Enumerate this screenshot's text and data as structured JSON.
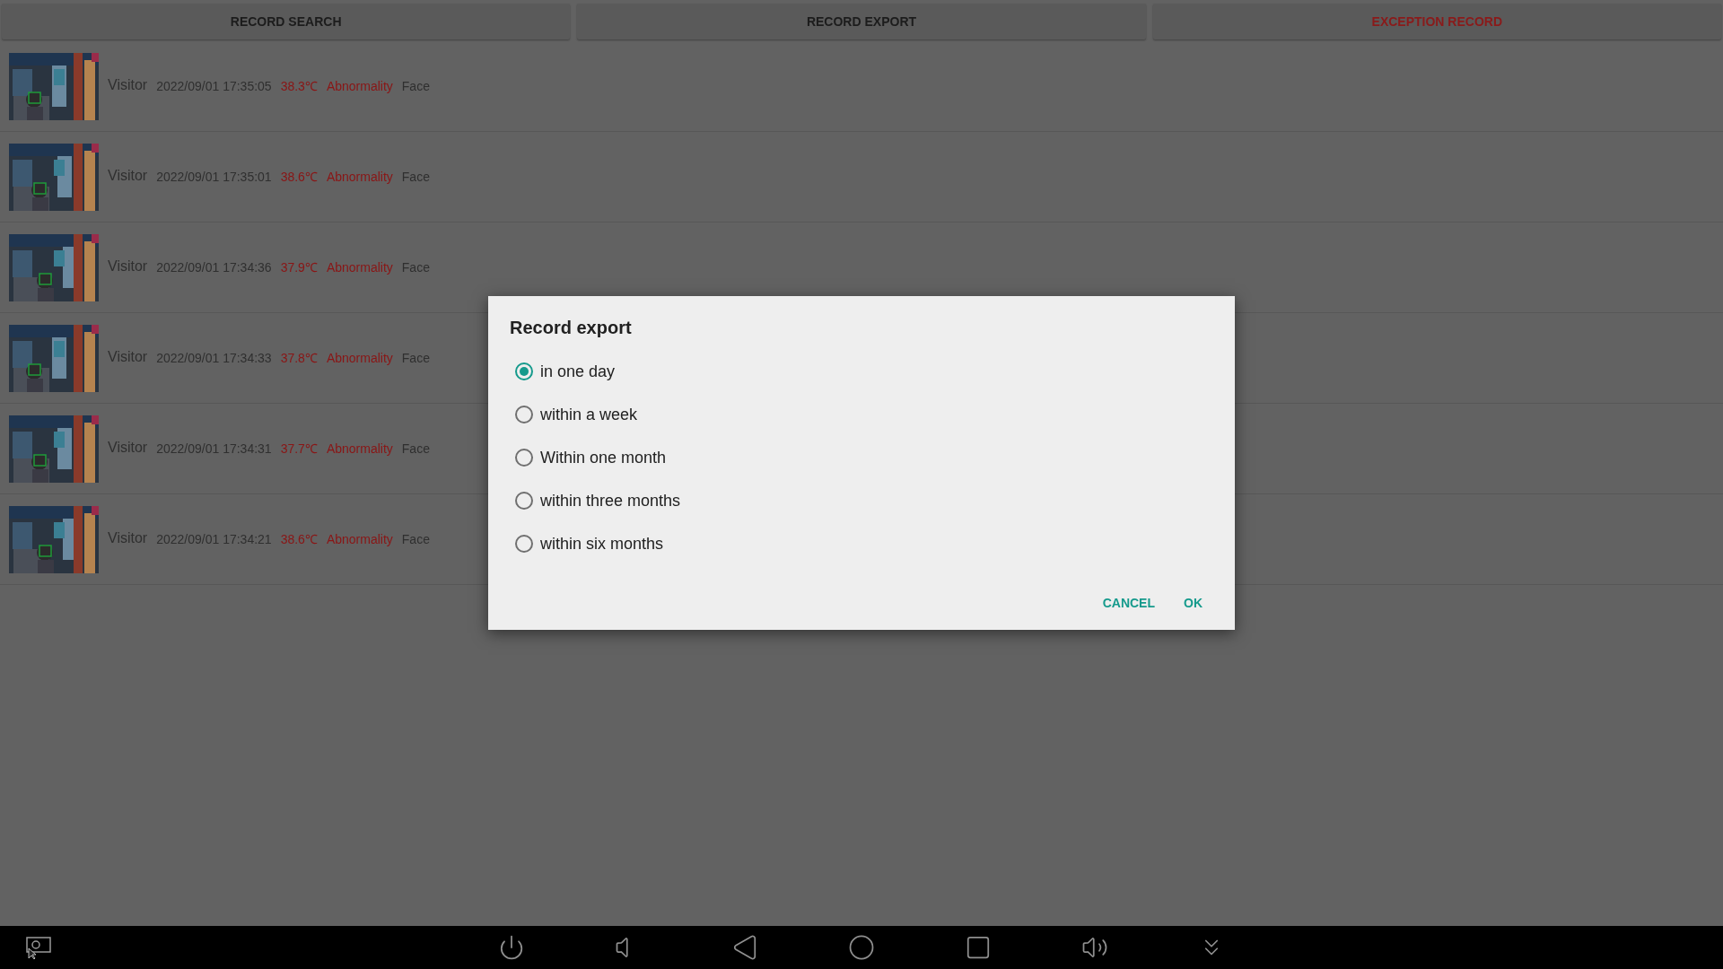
{
  "tabs": [
    {
      "label": "RECORD SEARCH",
      "selected": false
    },
    {
      "label": "RECORD EXPORT",
      "selected": false
    },
    {
      "label": "EXCEPTION RECORD",
      "selected": true
    }
  ],
  "records": [
    {
      "kind": "picture",
      "name": "Visitor",
      "time": "2022/09/01 17:35:05",
      "temperature": "38.3℃",
      "status": "Abnormality",
      "method": "Face"
    },
    {
      "kind": "picture",
      "name": "Visitor",
      "time": "2022/09/01 17:35:01",
      "temperature": "38.6℃",
      "status": "Abnormality",
      "method": "Face"
    },
    {
      "kind": "picture",
      "name": "Visitor",
      "time": "2022/09/01 17:34:36",
      "temperature": "37.9℃",
      "status": "Abnormality",
      "method": "Face"
    },
    {
      "kind": "picture",
      "name": "Visitor",
      "time": "2022/09/01 17:34:33",
      "temperature": "37.8℃",
      "status": "Abnormality",
      "method": "Face"
    },
    {
      "kind": "picture",
      "name": "Visitor",
      "time": "2022/09/01 17:34:31",
      "temperature": "37.7℃",
      "status": "Abnormality",
      "method": "Face"
    },
    {
      "kind": "picture",
      "name": "Visitor",
      "time": "2022/09/01 17:34:21",
      "temperature": "38.6℃",
      "status": "Abnormality",
      "method": "Face"
    }
  ],
  "dialog": {
    "title": "Record export",
    "options": [
      {
        "label": "in one day",
        "selected": true
      },
      {
        "label": "within a week",
        "selected": false
      },
      {
        "label": "Within one month",
        "selected": false
      },
      {
        "label": "within three months",
        "selected": false
      },
      {
        "label": "within six months",
        "selected": false
      }
    ],
    "buttons": [
      "CANCEL",
      "OK"
    ]
  }
}
